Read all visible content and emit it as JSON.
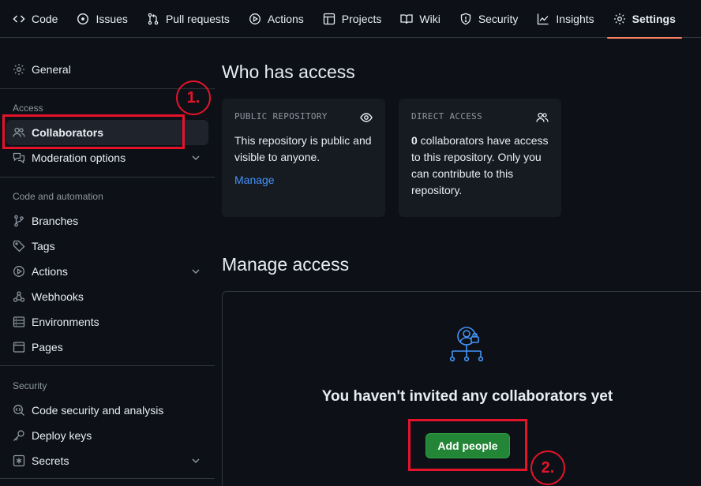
{
  "nav": {
    "tabs": [
      {
        "label": "Code",
        "icon": "code-icon"
      },
      {
        "label": "Issues",
        "icon": "issue-icon"
      },
      {
        "label": "Pull requests",
        "icon": "pull-request-icon"
      },
      {
        "label": "Actions",
        "icon": "play-icon"
      },
      {
        "label": "Projects",
        "icon": "table-icon"
      },
      {
        "label": "Wiki",
        "icon": "book-icon"
      },
      {
        "label": "Security",
        "icon": "shield-icon"
      },
      {
        "label": "Insights",
        "icon": "graph-icon"
      },
      {
        "label": "Settings",
        "icon": "gear-icon",
        "active": true
      }
    ]
  },
  "sidebar": {
    "general": "General",
    "access_heading": "Access",
    "collaborators": "Collaborators",
    "moderation": "Moderation options",
    "code_heading": "Code and automation",
    "branches": "Branches",
    "tags": "Tags",
    "actions": "Actions",
    "webhooks": "Webhooks",
    "environments": "Environments",
    "pages": "Pages",
    "security_heading": "Security",
    "code_security": "Code security and analysis",
    "deploy_keys": "Deploy keys",
    "secrets": "Secrets"
  },
  "main": {
    "who_title": "Who has access",
    "public_card": {
      "label": "PUBLIC REPOSITORY",
      "text": "This repository is public and visible to anyone.",
      "link": "Manage"
    },
    "direct_card": {
      "label": "DIRECT ACCESS",
      "count": "0",
      "text": " collaborators have access to this repository. Only you can contribute to this repository."
    },
    "manage_title": "Manage access",
    "empty_title": "You haven't invited any collaborators yet",
    "add_button": "Add people"
  },
  "annotations": {
    "step1": "1.",
    "step2": "2."
  },
  "colors": {
    "background": "#0d1117",
    "accent_underline": "#f78166",
    "link": "#4493f8",
    "button_green": "#238636",
    "annotation_red": "#e5132a"
  }
}
